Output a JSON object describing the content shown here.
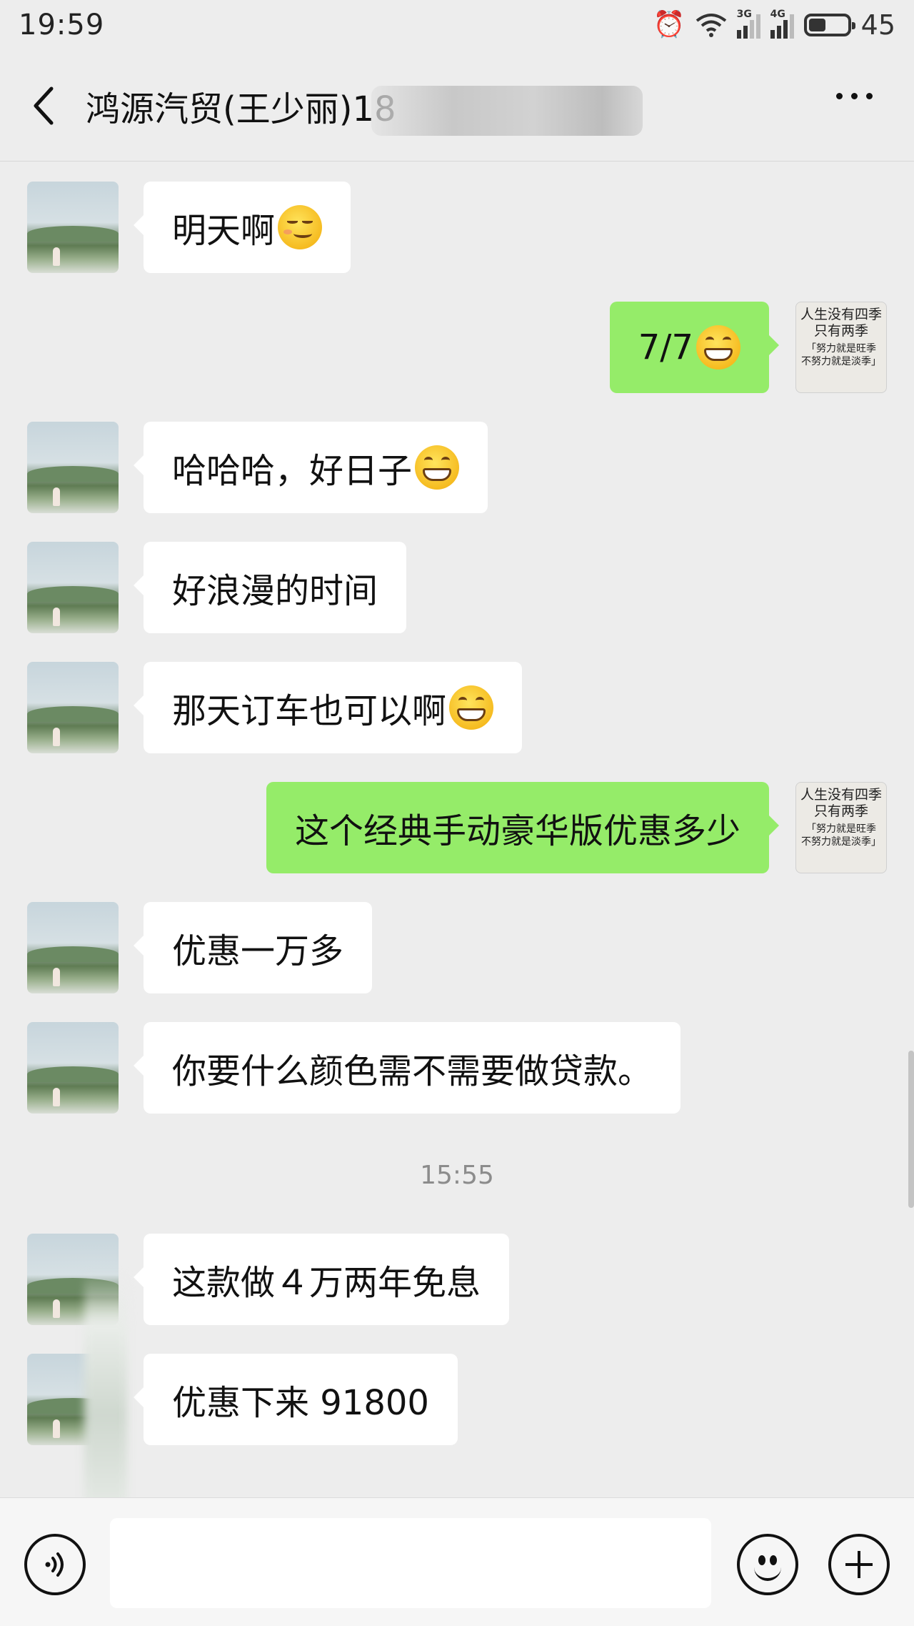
{
  "status_bar": {
    "time": "19:59",
    "network_3g": "3G",
    "network_4g": "4G",
    "battery_level": "45"
  },
  "header": {
    "title": "鸿源汽贸(王少丽)18"
  },
  "messages": [
    {
      "side": "left",
      "text": "明天啊",
      "emoji": "smirk-emoji"
    },
    {
      "side": "right",
      "text": "7/7",
      "emoji": "grin-emoji"
    },
    {
      "side": "left",
      "text": "哈哈哈，好日子",
      "emoji": "grin-emoji"
    },
    {
      "side": "left",
      "text": "好浪漫的时间",
      "emoji": ""
    },
    {
      "side": "left",
      "text": "那天订车也可以啊",
      "emoji": "grin-emoji"
    },
    {
      "side": "right",
      "text": "这个经典手动豪华版优惠多少",
      "emoji": ""
    },
    {
      "side": "left",
      "text": "优惠一万多",
      "emoji": ""
    },
    {
      "side": "left",
      "text": "你要什么颜色需不需要做贷款。",
      "emoji": ""
    },
    {
      "side": "left",
      "text": "这款做４万两年免息",
      "emoji": ""
    },
    {
      "side": "left",
      "text": "优惠下来 91800",
      "emoji": ""
    }
  ],
  "time_divider": "15:55",
  "my_avatar_text": {
    "line1": "人生没有四季",
    "line2": "只有两季",
    "line3": "「努力就是旺季",
    "line4": "不努力就是淡季」"
  },
  "input": {
    "value": "",
    "placeholder": ""
  },
  "colors": {
    "sent_bubble": "#95ec69",
    "received_bubble": "#ffffff",
    "background": "#ededed"
  }
}
